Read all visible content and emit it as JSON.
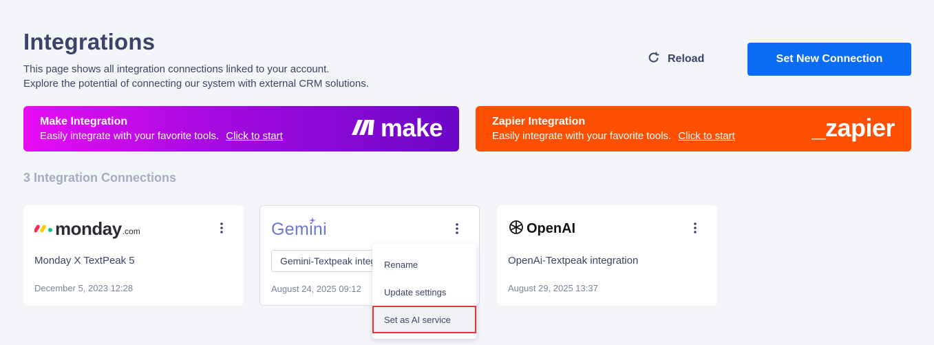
{
  "header": {
    "title": "Integrations",
    "description_line1": "This page shows all integration connections linked to your account.",
    "description_line2": "Explore the potential of connecting our system with external CRM solutions.",
    "reload_label": "Reload",
    "new_connection_label": "Set New Connection"
  },
  "banners": {
    "make": {
      "title": "Make Integration",
      "subtitle": "Easily integrate with your favorite tools.",
      "link": "Click to start",
      "logo_text": "make",
      "gradient": [
        "#e80cf4",
        "#6b06c8"
      ]
    },
    "zapier": {
      "title": "Zapier Integration",
      "subtitle": "Easily integrate with your favorite tools.",
      "link": "Click to start",
      "logo_text": "_zapier",
      "color": "#ff4f00"
    }
  },
  "connections": {
    "heading": "3 Integration Connections",
    "items": [
      {
        "logo": "monday-logo",
        "logo_word": "monday",
        "logo_suffix": ".com",
        "name": "Monday X TextPeak 5",
        "date": "December 5, 2023 12:28"
      },
      {
        "logo": "gemini-logo",
        "logo_word": "Gemini",
        "name": "Gemini-Textpeak integration",
        "date": "August 24, 2025 09:12",
        "editing": true
      },
      {
        "logo": "openai-logo",
        "logo_word": "OpenAI",
        "name": "OpenAi-Textpeak integration",
        "date": "August 29, 2025 13:37"
      }
    ]
  },
  "context_menu": {
    "items": [
      "Rename",
      "Update settings",
      "Set as AI service"
    ],
    "highlighted": "Set as AI service"
  },
  "colors": {
    "primary": "#0a6cf5",
    "highlight_border": "#e2363b",
    "background": "#f4f5f9"
  }
}
